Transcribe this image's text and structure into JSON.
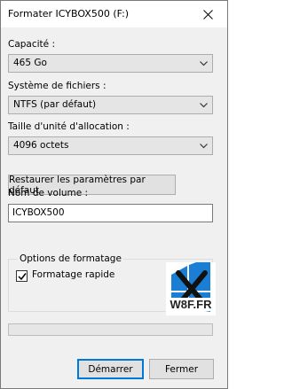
{
  "window": {
    "title": "Formater ICYBOX500 (F:)",
    "close_icon": "close-icon"
  },
  "capacity": {
    "label": "Capacité :",
    "value": "465 Go"
  },
  "filesystem": {
    "label": "Système de fichiers :",
    "value": "NTFS (par défaut)"
  },
  "allocation": {
    "label": "Taille d'unité d'allocation :",
    "value": "4096 octets"
  },
  "restore_button": "Restaurer les paramètres par défaut",
  "volume": {
    "label": "Nom de volume :",
    "value": "ICYBOX500"
  },
  "options": {
    "legend": "Options de formatage",
    "quick_format_label": "Formatage rapide",
    "quick_format_checked": true
  },
  "progress": {
    "value": 0
  },
  "watermark": {
    "text": "W8F.FR"
  },
  "buttons": {
    "start": "Démarrer",
    "close": "Fermer"
  },
  "colors": {
    "accent": "#0078d7",
    "window_bg": "#f0f0f0",
    "logo_blue": "#1a7fd4"
  }
}
